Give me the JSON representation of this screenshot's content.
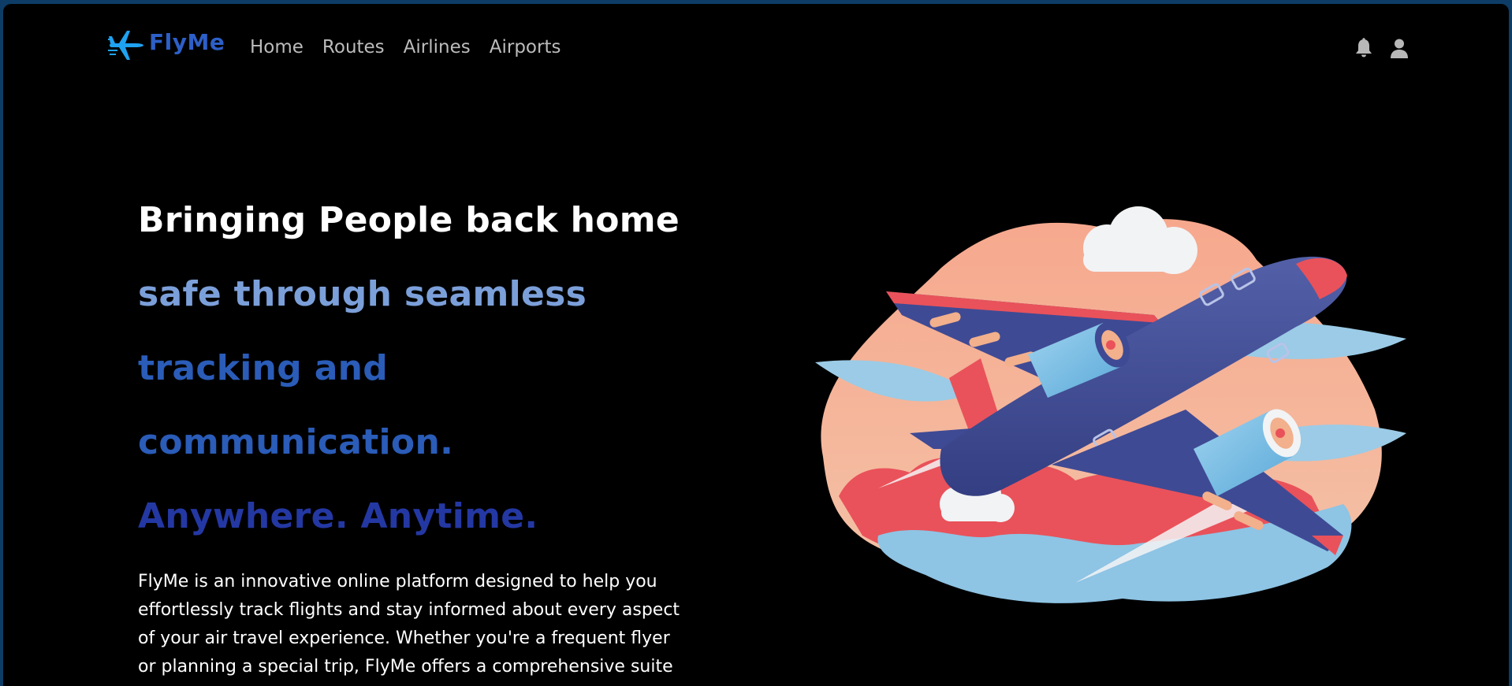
{
  "brand": {
    "name": "FlyMe",
    "icon": "airplane-icon",
    "color": "#2d5fc7"
  },
  "nav": {
    "links": [
      {
        "label": "Home"
      },
      {
        "label": "Routes"
      },
      {
        "label": "Airlines"
      },
      {
        "label": "Airports"
      }
    ],
    "icons": [
      "bell-icon",
      "user-icon"
    ]
  },
  "hero": {
    "lines": [
      "Bringing People back home",
      "safe through seamless",
      "tracking and communication.",
      "Anywhere. Anytime."
    ],
    "line_colors": [
      "#ffffff",
      "#7b9fd9",
      "#2a5cb8",
      "#2438a3"
    ],
    "description": "FlyMe is an innovative online platform designed to help you effortlessly track flights and stay informed about every aspect of your air travel experience. Whether you're a frequent flyer or planning a special trip, FlyMe offers a comprehensive suite of features to enhance your journey.",
    "illustration": "airplane-illustration"
  },
  "colors": {
    "background": "#000000",
    "frame": "#0d3d66",
    "nav_text": "#bcbcbc"
  }
}
